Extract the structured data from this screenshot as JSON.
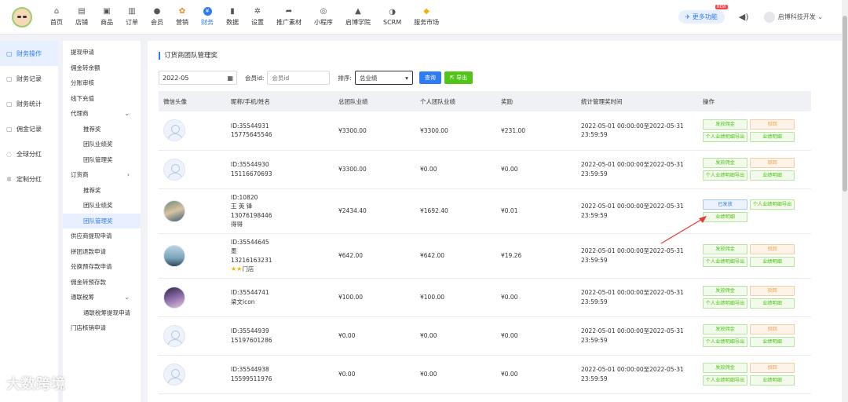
{
  "nav": [
    {
      "label": "首页",
      "icon": "home-icon"
    },
    {
      "label": "店铺",
      "icon": "store-icon"
    },
    {
      "label": "商品",
      "icon": "goods-icon"
    },
    {
      "label": "订单",
      "icon": "order-icon"
    },
    {
      "label": "会员",
      "icon": "member-icon"
    },
    {
      "label": "营销",
      "icon": "marketing-icon"
    },
    {
      "label": "财务",
      "icon": "finance-icon",
      "active": true
    },
    {
      "label": "数据",
      "icon": "data-icon"
    },
    {
      "label": "设置",
      "icon": "settings-icon"
    },
    {
      "label": "推广素材",
      "icon": "share-icon"
    },
    {
      "label": "小程序",
      "icon": "miniprogram-icon"
    },
    {
      "label": "启博学院",
      "icon": "academy-icon"
    },
    {
      "label": "SCRM",
      "icon": "scrm-icon"
    },
    {
      "label": "服务市场",
      "icon": "market-icon"
    }
  ],
  "header": {
    "more_label": "更多功能",
    "new_badge": "NEW",
    "user_name": "启博科技开发"
  },
  "left_menu": [
    {
      "label": "财务操作",
      "active": true
    },
    {
      "label": "财务记录"
    },
    {
      "label": "财务统计"
    },
    {
      "label": "佣金记录"
    },
    {
      "label": "全球分红"
    },
    {
      "label": "定制分红"
    }
  ],
  "submenu": {
    "items": [
      "提现申请",
      "佣金转余额",
      "分账审核",
      "线下充值",
      "代理商",
      "推荐奖",
      "团队业绩奖",
      "团队管理奖",
      "订货商",
      "推荐奖",
      "团队业绩奖",
      "团队管理奖",
      "供应商提现申请",
      "拼团退款申请",
      "兑换预存款申请",
      "佣金转预存款",
      "通联税筹",
      "通联税筹提现申请",
      "门店核销申请"
    ]
  },
  "page": {
    "title": "订货商团队管理奖",
    "date_value": "2022-05",
    "member_label": "会员id:",
    "member_placeholder": "会员id",
    "sort_label": "排序:",
    "sort_value": "总业绩",
    "query_label": "查询",
    "export_label": "导出"
  },
  "table": {
    "headers": [
      "微信头像",
      "昵称/手机/姓名",
      "总团队业绩",
      "个人团队业绩",
      "奖励",
      "统计管理奖时间",
      "操作"
    ],
    "rows": [
      {
        "lines": [
          "ID:35544931",
          "15775645546"
        ],
        "total": "¥3300.00",
        "personal": "¥3300.00",
        "reward": "¥231.00",
        "time": "2022-05-01 00:00:00至2022-05-31 23:59:59"
      },
      {
        "lines": [
          "ID:35544930",
          "15116670693"
        ],
        "total": "¥3300.00",
        "personal": "¥0.00",
        "reward": "¥0.00",
        "time": "2022-05-01 00:00:00至2022-05-31 23:59:59"
      },
      {
        "lines": [
          "ID:10820",
          "王 英 锋",
          "13076198446",
          "得得"
        ],
        "total": "¥2434.40",
        "personal": "¥1692.40",
        "reward": "¥0.01",
        "time": "2022-05-01 00:00:00至2022-05-31 23:59:59"
      },
      {
        "lines": [
          "ID:35544645",
          "墨",
          "13216163231"
        ],
        "star_label": "门店",
        "total": "¥642.00",
        "personal": "¥642.00",
        "reward": "¥19.26",
        "time": "2022-05-01 00:00:00至2022-05-31 23:59:59"
      },
      {
        "lines": [
          "ID:35544741",
          "梁文icon"
        ],
        "total": "¥100.00",
        "personal": "¥100.00",
        "reward": "¥0.00",
        "time": "2022-05-01 00:00:00至2022-05-31 23:59:59"
      },
      {
        "lines": [
          "ID:35544939",
          "15197601286"
        ],
        "total": "¥0.00",
        "personal": "¥0.00",
        "reward": "¥0.00",
        "time": "2022-05-01 00:00:00至2022-05-31 23:59:59"
      },
      {
        "lines": [
          "ID:35544938",
          "15599511976"
        ],
        "total": "¥0.00",
        "personal": "¥0.00",
        "reward": "¥0.00",
        "time": "2022-05-01 00:00:00至2022-05-31 23:59:59"
      }
    ],
    "ops": {
      "issue": "发放佣金",
      "revoke": "驳回",
      "export_detail": "个人业绩明细导出",
      "detail": "业绩明细",
      "issued": "已发放"
    }
  },
  "watermark": "大数跨境",
  "colors": {
    "accent": "#2d7cf6",
    "success": "#52c41a",
    "warning": "#f0a04b",
    "arrow": "#e53935"
  }
}
